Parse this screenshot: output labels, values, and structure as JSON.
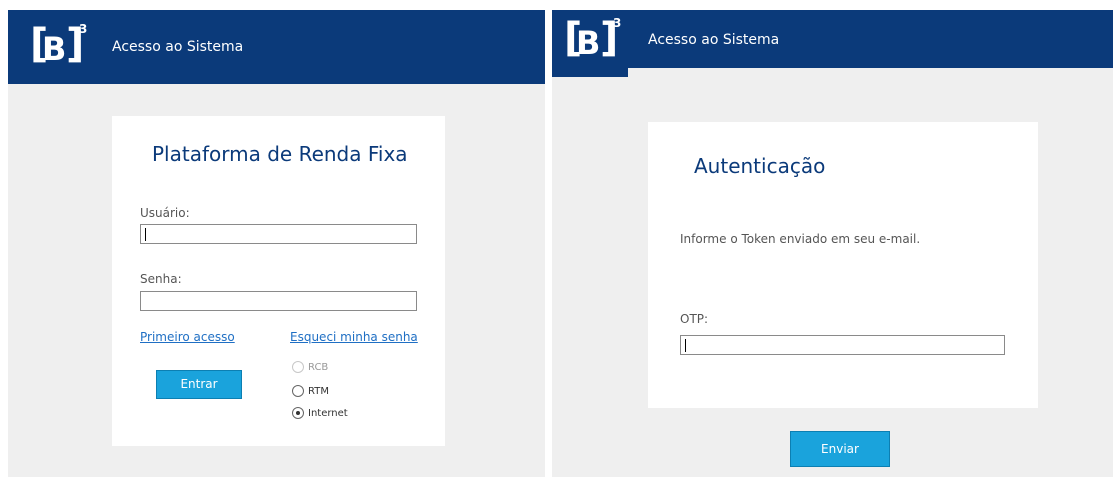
{
  "left_panel": {
    "header": {
      "logo_text": "[B]³",
      "title": "Acesso ao Sistema"
    },
    "card": {
      "title": "Plataforma de Renda Fixa",
      "username_label": "Usuário:",
      "username_value": "",
      "password_label": "Senha:",
      "password_value": "",
      "first_access_link": "Primeiro acesso",
      "forgot_password_link": "Esqueci minha senha",
      "submit_label": "Entrar",
      "network_options": [
        {
          "label": "RCB",
          "checked": false,
          "disabled": true
        },
        {
          "label": "RTM",
          "checked": false,
          "disabled": false
        },
        {
          "label": "Internet",
          "checked": true,
          "disabled": false
        }
      ]
    }
  },
  "right_panel": {
    "header": {
      "logo_text": "[B]³",
      "title": "Acesso ao Sistema"
    },
    "card": {
      "title": "Autenticação",
      "instruction": "Informe o Token enviado em seu e-mail.",
      "otp_label": "OTP:",
      "otp_value": ""
    },
    "submit_label": "Enviar"
  },
  "colors": {
    "header_bg": "#0b3a7a",
    "button_bg": "#1aa3dc",
    "link": "#1f6fc4",
    "panel_bg": "#efefef"
  }
}
